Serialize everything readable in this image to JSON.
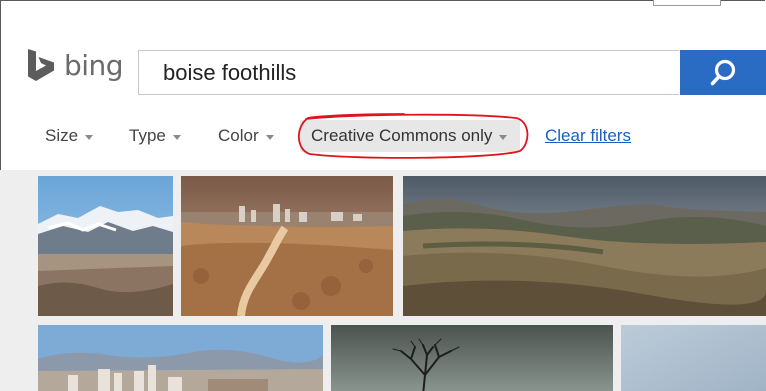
{
  "brand": {
    "logo_text": "bing",
    "logo_icon": "bing-b-icon"
  },
  "search": {
    "query": "boise foothills",
    "button_icon": "search-icon",
    "accent_color": "#2a6cc4"
  },
  "filters": {
    "items": [
      {
        "label": "Size"
      },
      {
        "label": "Type"
      },
      {
        "label": "Color"
      },
      {
        "label": "Creative Commons only"
      }
    ],
    "clear_label": "Clear filters",
    "highlight_color": "#e0141e"
  },
  "results": {
    "thumbnails": [
      {
        "subject": "snowy-mountain-ridge"
      },
      {
        "subject": "city-skyline-trail"
      },
      {
        "subject": "rolling-foothills"
      },
      {
        "subject": "downtown-skyline"
      },
      {
        "subject": "bare-tree-silhouette"
      },
      {
        "subject": "pale-sky"
      }
    ]
  }
}
